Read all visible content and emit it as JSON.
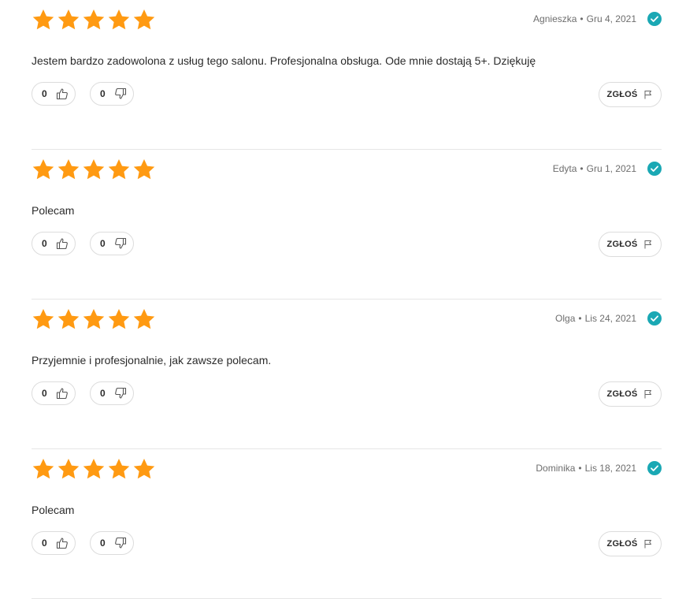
{
  "colors": {
    "star": "#FF9A12",
    "verified": "#1AA8B4",
    "border": "#dcdcdc"
  },
  "reviews": [
    {
      "rating": 5,
      "author": "Agnieszka",
      "separator": "•",
      "date": "Gru 4, 2021",
      "text": "Jestem bardzo zadowolona z usług tego salonu. Profesjonalna obsługa. Ode mnie dostają 5+. Dziękuję",
      "likes": "0",
      "dislikes": "0",
      "report_label": "ZGŁOŚ"
    },
    {
      "rating": 5,
      "author": "Edyta",
      "separator": "•",
      "date": "Gru 1, 2021",
      "text": "Polecam",
      "likes": "0",
      "dislikes": "0",
      "report_label": "ZGŁOŚ"
    },
    {
      "rating": 5,
      "author": "Olga",
      "separator": "•",
      "date": "Lis 24, 2021",
      "text": "Przyjemnie i profesjonalnie, jak zawsze polecam.",
      "likes": "0",
      "dislikes": "0",
      "report_label": "ZGŁOŚ"
    },
    {
      "rating": 5,
      "author": "Dominika",
      "separator": "•",
      "date": "Lis 18, 2021",
      "text": "Polecam",
      "likes": "0",
      "dislikes": "0",
      "report_label": "ZGŁOŚ"
    }
  ],
  "icons": {
    "star": "star-icon",
    "verified": "verified-check-icon",
    "like": "thumbs-up-icon",
    "dislike": "thumbs-down-icon",
    "report": "flag-icon"
  }
}
